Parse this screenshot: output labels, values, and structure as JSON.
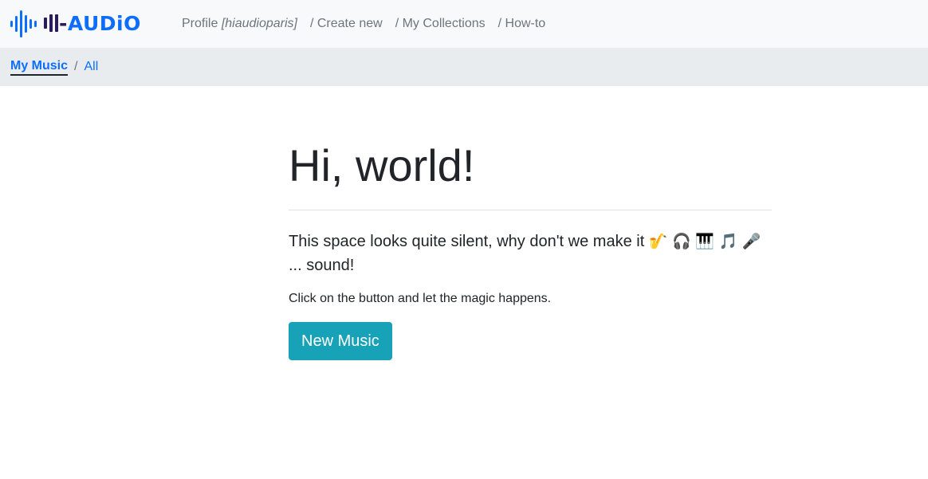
{
  "brand": {
    "mark_text": "Hi-",
    "mark_h": "H",
    "dash": "-",
    "audio_text": "AUDiO",
    "icon": "audio-wave-icon",
    "colors": {
      "dark": "#2b1b5e",
      "blue": "#0d6efd"
    }
  },
  "nav": {
    "profile_label": "Profile",
    "profile_user": "[hiaudioparis]",
    "create_new": "/ Create new",
    "my_collections": "/ My Collections",
    "how_to": "/ How-to"
  },
  "breadcrumb": {
    "active": "My Music",
    "separator": "/",
    "current": "All"
  },
  "main": {
    "title": "Hi, world!",
    "lead_text": "This space looks quite silent, why don't we make it",
    "emojis": [
      "🎷",
      "🎧",
      "🎹",
      "🎵",
      "🎤"
    ],
    "lead_tail": "... sound!",
    "hint": "Click on the button and let the magic happens.",
    "button_label": "New Music"
  },
  "colors": {
    "navbar_bg": "#f8f9fa",
    "breadcrumb_bg": "#e9ecef",
    "link": "#0d6efd",
    "button_bg": "#17a2b8"
  }
}
